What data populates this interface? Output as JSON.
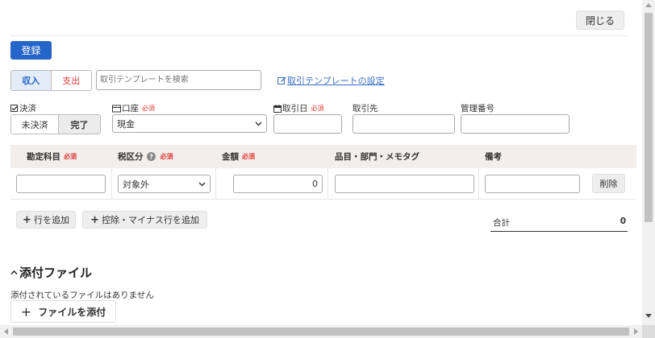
{
  "header": {
    "close_label": "閉じる"
  },
  "toolbar": {
    "register_label": "登録"
  },
  "type_toggle": {
    "income_label": "収入",
    "expense_label": "支出"
  },
  "template": {
    "search_placeholder": "取引テンプレートを検索",
    "settings_link": "取引テンプレートの設定"
  },
  "fields": {
    "settlement_label": "決済",
    "unsettled_label": "未決済",
    "completed_label": "完了",
    "account_label": "口座",
    "account_value": "現金",
    "date_label": "取引日",
    "partner_label": "取引先",
    "manage_no_label": "管理番号",
    "required": "必須"
  },
  "table": {
    "headers": {
      "account_item": "勘定科目",
      "tax": "税区分",
      "amount": "金額",
      "item_memo": "品目・部門・メモタグ",
      "remarks": "備考"
    },
    "row": {
      "tax_value": "対象外",
      "amount_value": "0",
      "delete_label": "削除"
    }
  },
  "actions": {
    "add_row": "行を追加",
    "add_deduction_row": "控除・マイナス行を追加"
  },
  "total": {
    "label": "合計",
    "value": "0"
  },
  "attachments": {
    "title": "添付ファイル",
    "empty_text": "添付されているファイルはありません",
    "add_label": "ファイルを添付"
  },
  "colors": {
    "primary": "#2564c9",
    "link": "#3a6fc4",
    "required": "#e53935",
    "header_bg": "#f1eeec"
  }
}
